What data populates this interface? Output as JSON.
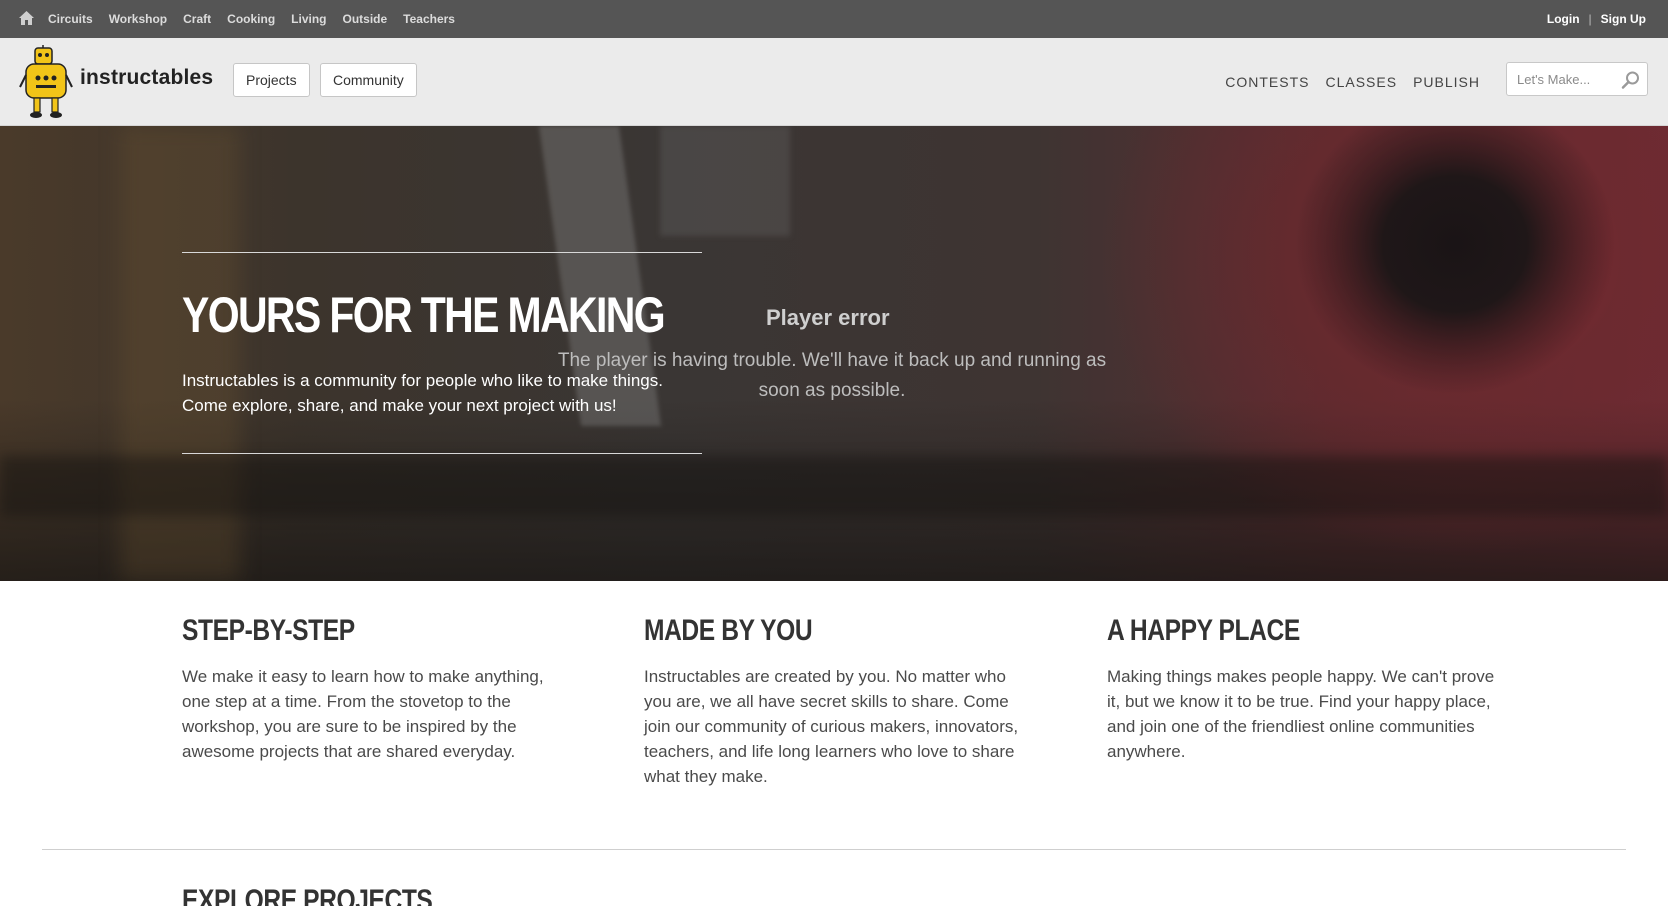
{
  "topbar": {
    "categories": [
      "Circuits",
      "Workshop",
      "Craft",
      "Cooking",
      "Living",
      "Outside",
      "Teachers"
    ],
    "login": "Login",
    "separator": "|",
    "signup": "Sign Up"
  },
  "header": {
    "brand": "instructables",
    "nav_buttons": [
      "Projects",
      "Community"
    ],
    "links": [
      "CONTESTS",
      "CLASSES",
      "PUBLISH"
    ],
    "search_placeholder": "Let's Make..."
  },
  "hero": {
    "headline": "YOURS FOR THE MAKING",
    "intro": "Instructables is a community for people who like to make things. Come explore, share, and make your next project with us!",
    "player_error_title": "Player error",
    "player_error_message": "The player is having trouble. We'll have it back up and running as soon as possible."
  },
  "features": [
    {
      "title": "STEP-BY-STEP",
      "text": "We make it easy to learn how to make anything, one step at a time. From the stovetop to the workshop, you are sure to be inspired by the awesome projects that are shared everyday."
    },
    {
      "title": "MADE BY YOU",
      "text": "Instructables are created by you. No matter who you are, we all have secret skills to share. Come join our community of curious makers, innovators, teachers, and life long learners who love to share what they make."
    },
    {
      "title": "A HAPPY PLACE",
      "text": "Making things makes people happy. We can't prove it, but we know it to be true. Find your happy place, and join one of the friendliest online communities anywhere."
    }
  ],
  "explore_heading": "EXPLORE PROJECTS",
  "colors": {
    "topbar_bg": "#555555",
    "header_bg": "#ebebeb",
    "robot_yellow": "#f2c418"
  },
  "icons": {
    "home": "home-icon",
    "logo": "instructables-robot-icon",
    "search": "magnifier-icon"
  }
}
